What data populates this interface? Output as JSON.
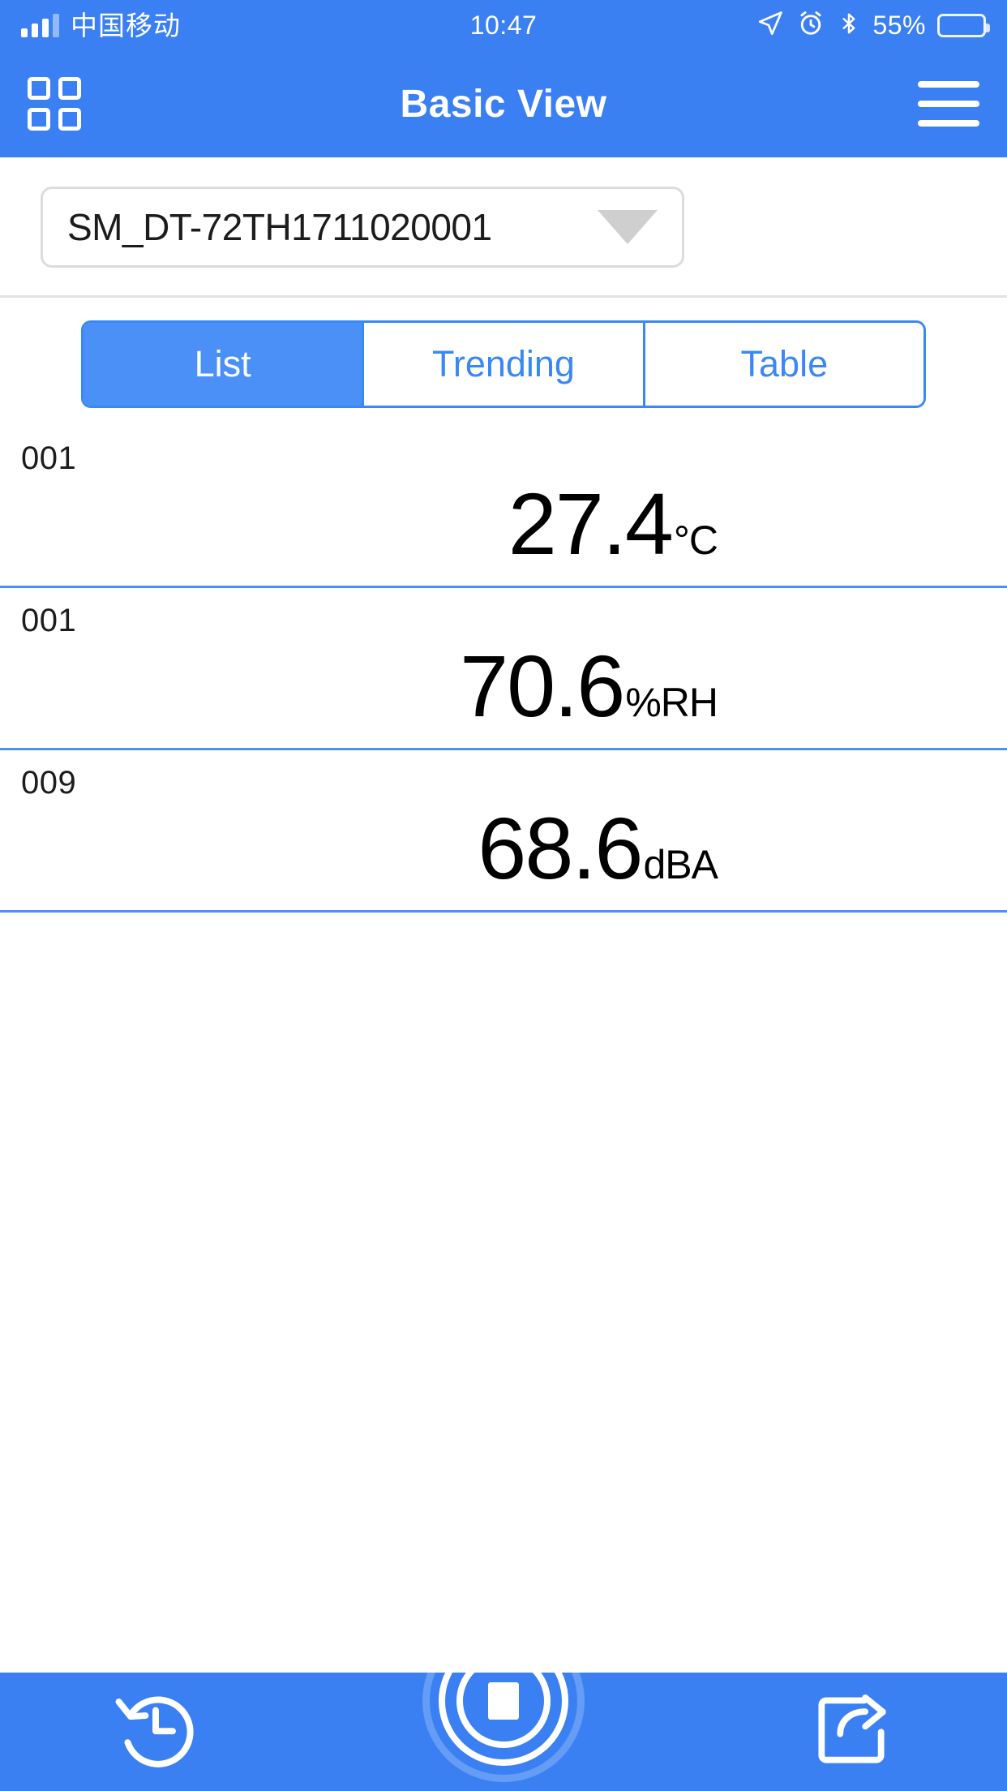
{
  "status_bar": {
    "carrier": "中国移动",
    "time": "10:47",
    "battery_percent": "55%",
    "icons": [
      "signal-bars-icon",
      "location-arrow-icon",
      "alarm-clock-icon",
      "bluetooth-icon",
      "battery-icon"
    ]
  },
  "nav_bar": {
    "title": "Basic View",
    "left_icon": "grid-apps-icon",
    "right_icon": "hamburger-menu-icon"
  },
  "device_select": {
    "value": "SM_DT-72TH1711020001",
    "caret_icon": "chevron-down-icon"
  },
  "tabs": [
    {
      "label": "List",
      "active": true
    },
    {
      "label": "Trending",
      "active": false
    },
    {
      "label": "Table",
      "active": false
    }
  ],
  "readings": [
    {
      "id": "001",
      "value": "27.4",
      "unit": "°C"
    },
    {
      "id": "001",
      "value": "70.6",
      "unit": "%RH"
    },
    {
      "id": "009",
      "value": "68.6",
      "unit": "dBA"
    }
  ],
  "toolbar": {
    "history_icon": "history-clock-icon",
    "record_icon": "stop-record-button-icon",
    "share_icon": "share-export-icon"
  },
  "colors": {
    "brand_blue": "#3a80f2",
    "tab_blue": "#4a90f7",
    "divider_blue": "#4a90f7",
    "text_dark": "#000000"
  }
}
